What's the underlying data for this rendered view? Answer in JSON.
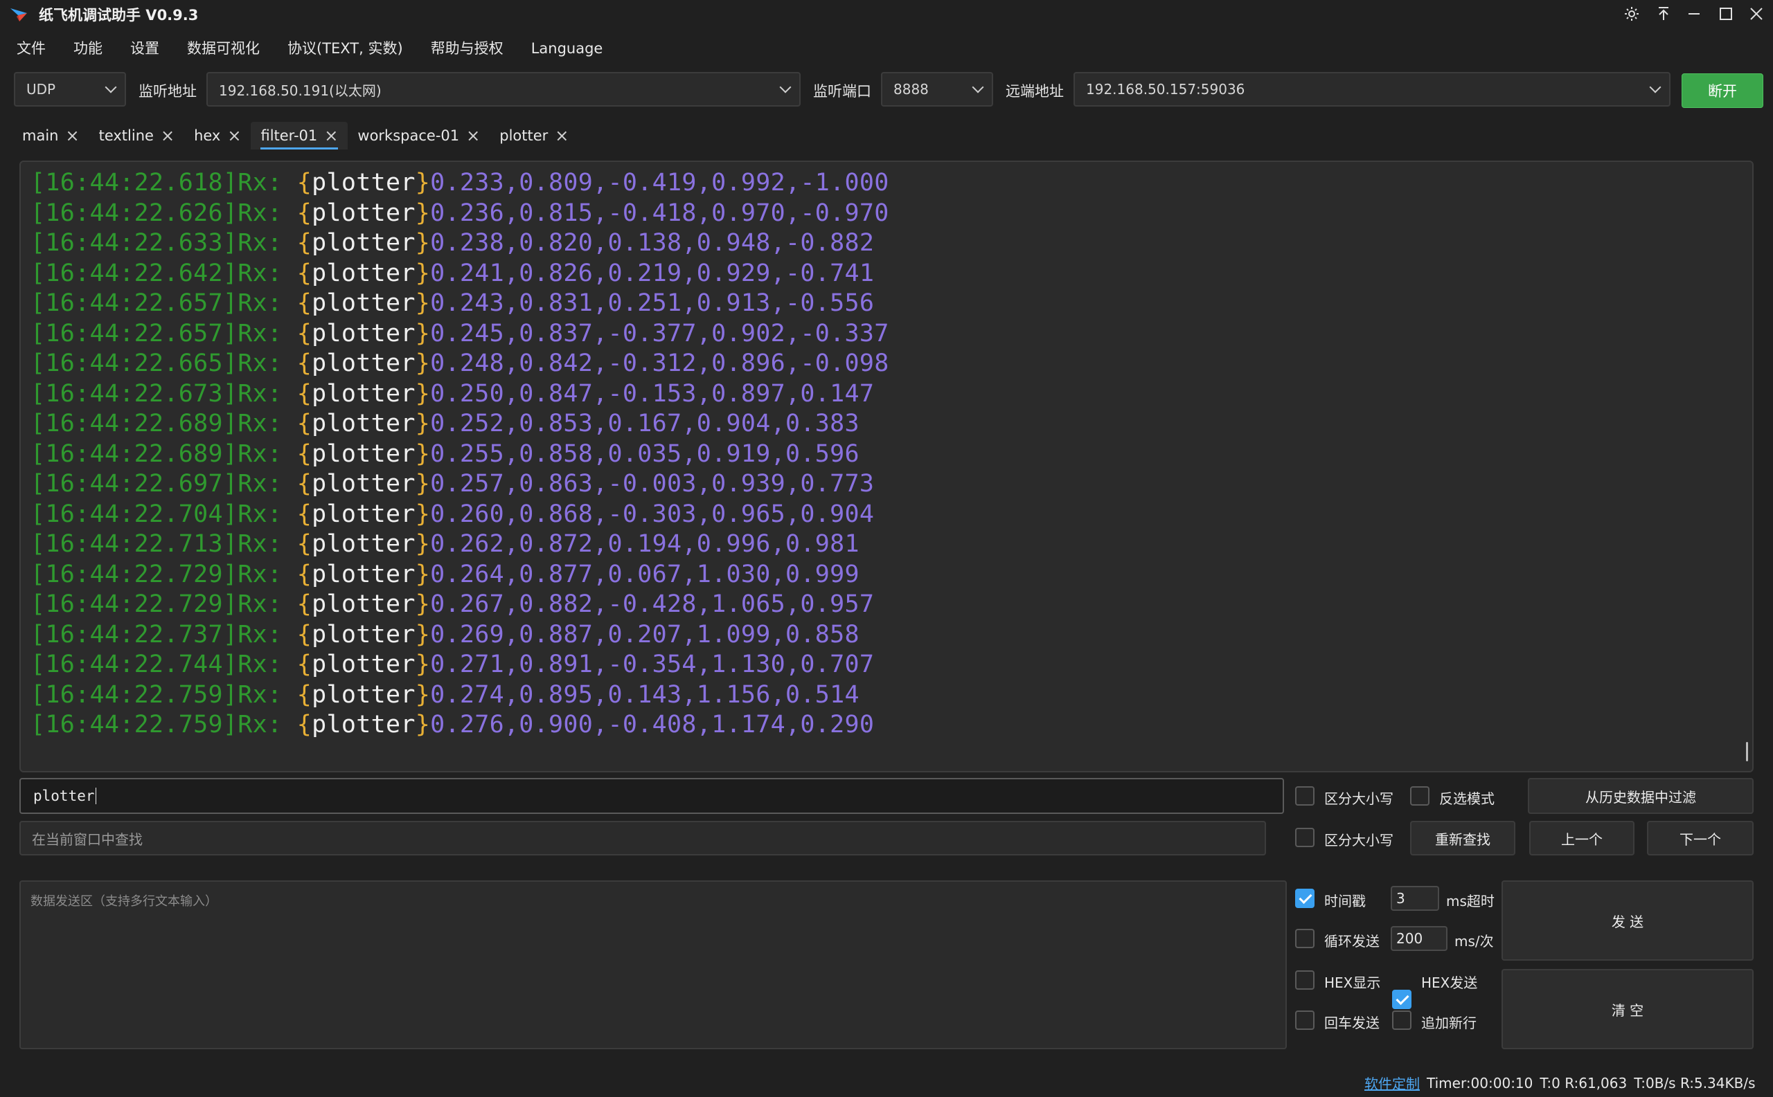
{
  "window": {
    "title": "纸飞机调试助手 V0.9.3"
  },
  "menu": [
    "文件",
    "功能",
    "设置",
    "数据可视化",
    "协议(TEXT, 实数)",
    "帮助与授权",
    "Language"
  ],
  "toolbar": {
    "protocol": "UDP",
    "listen_addr_label": "监听地址",
    "listen_addr": "192.168.50.191(以太网)",
    "listen_port_label": "监听端口",
    "listen_port": "8888",
    "remote_addr_label": "远端地址",
    "remote_addr": "192.168.50.157:59036",
    "disconnect_label": "断开",
    "disconnect_color": "#3aa64a"
  },
  "tabs": [
    {
      "label": "main",
      "active": false
    },
    {
      "label": "textline",
      "active": false
    },
    {
      "label": "hex",
      "active": false
    },
    {
      "label": "filter-01",
      "active": true
    },
    {
      "label": "workspace-01",
      "active": false
    },
    {
      "label": "plotter",
      "active": false
    }
  ],
  "log": {
    "lines": [
      {
        "ts": "[16:44:22.618]",
        "dir": "Rx: ",
        "tag": "plotter",
        "values": "0.233,0.809,-0.419,0.992,-1.000"
      },
      {
        "ts": "[16:44:22.626]",
        "dir": "Rx: ",
        "tag": "plotter",
        "values": "0.236,0.815,-0.418,0.970,-0.970"
      },
      {
        "ts": "[16:44:22.633]",
        "dir": "Rx: ",
        "tag": "plotter",
        "values": "0.238,0.820,0.138,0.948,-0.882"
      },
      {
        "ts": "[16:44:22.642]",
        "dir": "Rx: ",
        "tag": "plotter",
        "values": "0.241,0.826,0.219,0.929,-0.741"
      },
      {
        "ts": "[16:44:22.657]",
        "dir": "Rx: ",
        "tag": "plotter",
        "values": "0.243,0.831,0.251,0.913,-0.556"
      },
      {
        "ts": "[16:44:22.657]",
        "dir": "Rx: ",
        "tag": "plotter",
        "values": "0.245,0.837,-0.377,0.902,-0.337"
      },
      {
        "ts": "[16:44:22.665]",
        "dir": "Rx: ",
        "tag": "plotter",
        "values": "0.248,0.842,-0.312,0.896,-0.098"
      },
      {
        "ts": "[16:44:22.673]",
        "dir": "Rx: ",
        "tag": "plotter",
        "values": "0.250,0.847,-0.153,0.897,0.147"
      },
      {
        "ts": "[16:44:22.689]",
        "dir": "Rx: ",
        "tag": "plotter",
        "values": "0.252,0.853,0.167,0.904,0.383"
      },
      {
        "ts": "[16:44:22.689]",
        "dir": "Rx: ",
        "tag": "plotter",
        "values": "0.255,0.858,0.035,0.919,0.596"
      },
      {
        "ts": "[16:44:22.697]",
        "dir": "Rx: ",
        "tag": "plotter",
        "values": "0.257,0.863,-0.003,0.939,0.773"
      },
      {
        "ts": "[16:44:22.704]",
        "dir": "Rx: ",
        "tag": "plotter",
        "values": "0.260,0.868,-0.303,0.965,0.904"
      },
      {
        "ts": "[16:44:22.713]",
        "dir": "Rx: ",
        "tag": "plotter",
        "values": "0.262,0.872,0.194,0.996,0.981"
      },
      {
        "ts": "[16:44:22.729]",
        "dir": "Rx: ",
        "tag": "plotter",
        "values": "0.264,0.877,0.067,1.030,0.999"
      },
      {
        "ts": "[16:44:22.729]",
        "dir": "Rx: ",
        "tag": "plotter",
        "values": "0.267,0.882,-0.428,1.065,0.957"
      },
      {
        "ts": "[16:44:22.737]",
        "dir": "Rx: ",
        "tag": "plotter",
        "values": "0.269,0.887,0.207,1.099,0.858"
      },
      {
        "ts": "[16:44:22.744]",
        "dir": "Rx: ",
        "tag": "plotter",
        "values": "0.271,0.891,-0.354,1.130,0.707"
      },
      {
        "ts": "[16:44:22.759]",
        "dir": "Rx: ",
        "tag": "plotter",
        "values": "0.274,0.895,0.143,1.156,0.514"
      },
      {
        "ts": "[16:44:22.759]",
        "dir": "Rx: ",
        "tag": "plotter",
        "values": "0.276,0.900,-0.408,1.174,0.290"
      }
    ]
  },
  "filter": {
    "value": "plotter",
    "case_label": "区分大小写",
    "case_checked": false,
    "invert_label": "反选模式",
    "invert_checked": false,
    "history_filter_label": "从历史数据中过滤"
  },
  "search": {
    "placeholder": "在当前窗口中查找",
    "case_label": "区分大小写",
    "case_checked": false,
    "research_label": "重新查找",
    "prev_label": "上一个",
    "next_label": "下一个"
  },
  "send": {
    "placeholder": "数据发送区（支持多行文本输入）",
    "timestamp_label": "时间戳",
    "timestamp_checked": true,
    "timeout_value": "3",
    "timeout_unit": "ms超时",
    "loop_label": "循环发送",
    "loop_checked": false,
    "interval_value": "200",
    "interval_unit": "ms/次",
    "hex_display_label": "HEX显示",
    "hex_display_checked": false,
    "hex_send_label": "HEX发送",
    "hex_send_checked": true,
    "enter_send_label": "回车发送",
    "enter_send_checked": false,
    "append_newline_label": "追加新行",
    "append_newline_checked": false,
    "send_label": "发 送",
    "clear_label": "清 空"
  },
  "status": {
    "custom_link": "软件定制",
    "timer": "Timer:00:00:10",
    "counts": "T:0 R:61,063",
    "rates": "T:0B/s R:5.34KB/s"
  }
}
